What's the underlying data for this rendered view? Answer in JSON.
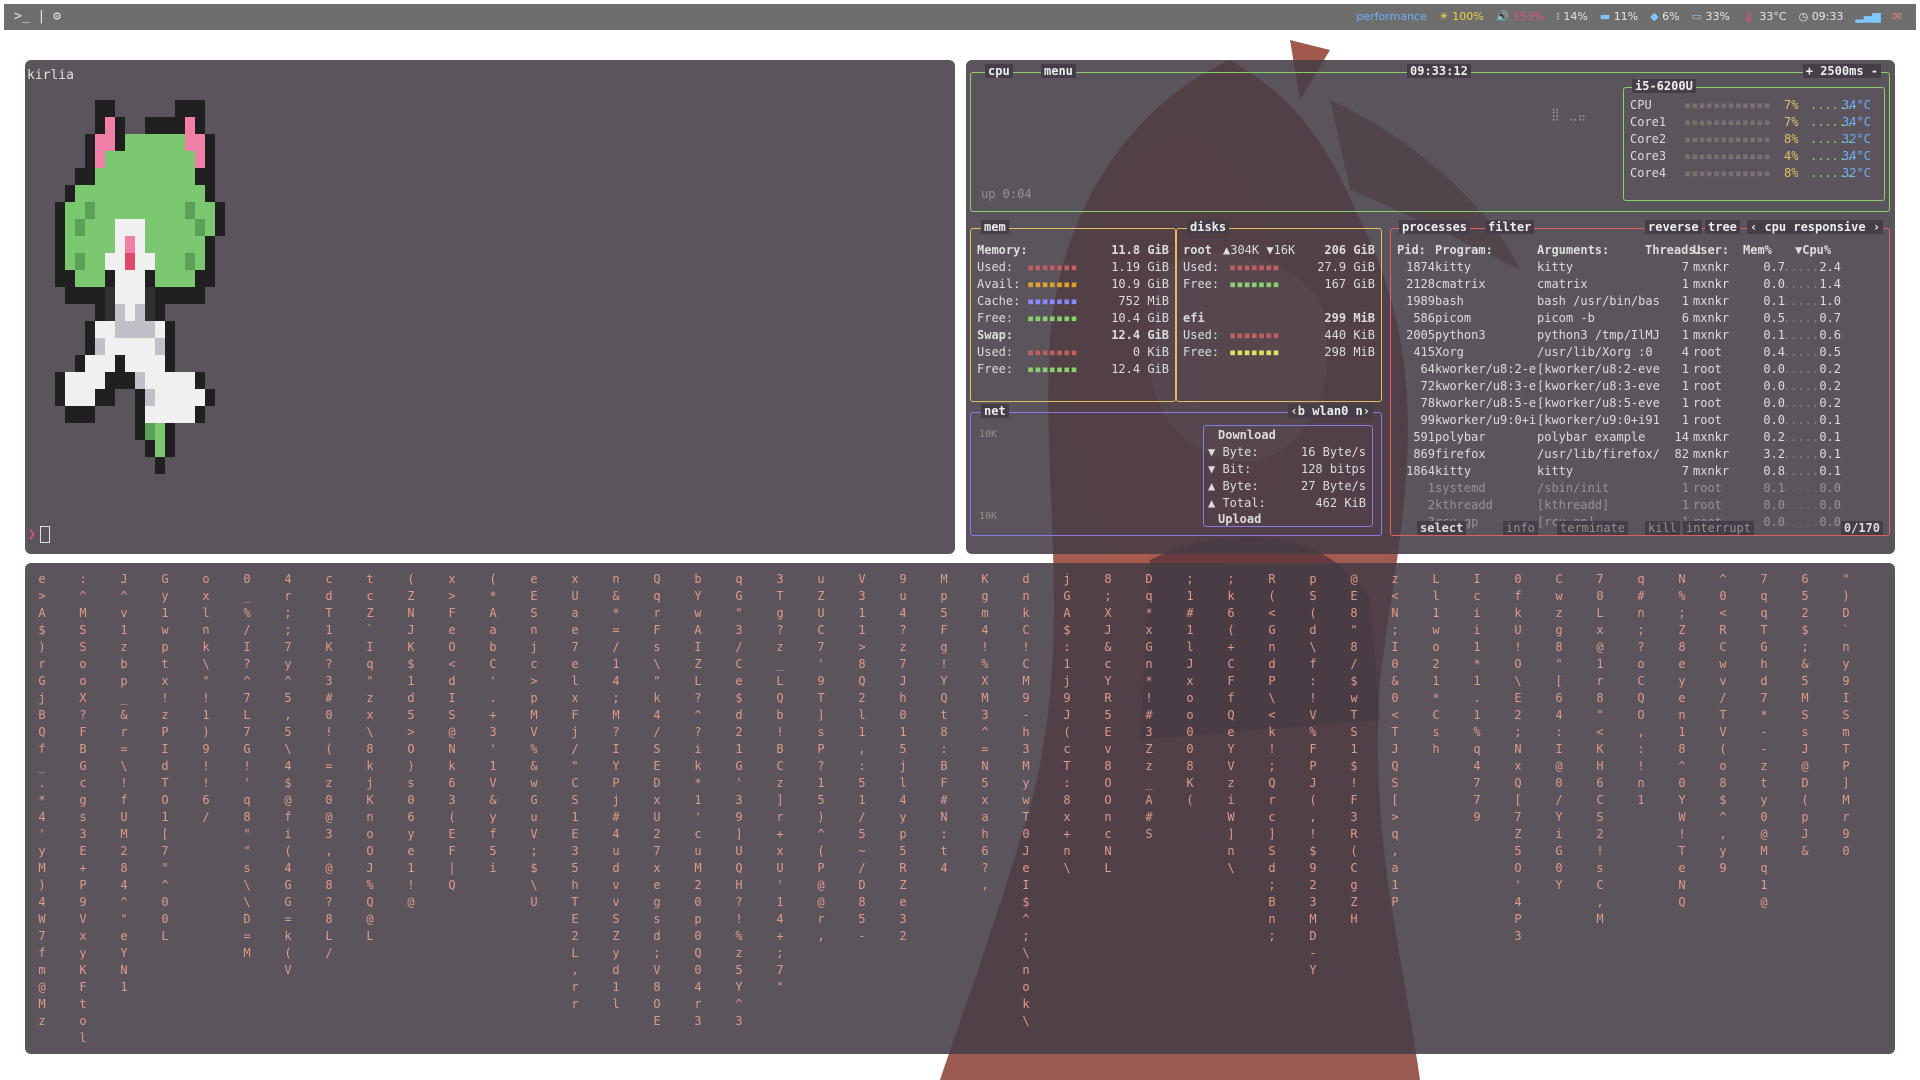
{
  "topbar": {
    "left_icon": "terminal-icon",
    "separator": "|",
    "gear": "gear-icon",
    "profile": "performance",
    "brightness": "100%",
    "volume": "153%",
    "cpu": "14%",
    "mem": "11%",
    "disk": "6%",
    "battery": "33%",
    "temp": "33°C",
    "clock": "09:33"
  },
  "kitty": {
    "title": "kirlia",
    "prompt": "❯"
  },
  "btop": {
    "cpu": {
      "tab_cpu": "cpu",
      "tab_menu": "menu",
      "clock": "09:33:12",
      "interval": "+ 2500ms -",
      "uptime": "up 0:04",
      "model": "i5-6200U",
      "cores": [
        {
          "name": "CPU",
          "pct": "7%",
          "temp": "34°C"
        },
        {
          "name": "Core1",
          "pct": "7%",
          "temp": "34°C"
        },
        {
          "name": "Core2",
          "pct": "8%",
          "temp": "32°C"
        },
        {
          "name": "Core3",
          "pct": "4%",
          "temp": "34°C"
        },
        {
          "name": "Core4",
          "pct": "8%",
          "temp": "32°C"
        }
      ]
    },
    "mem": {
      "label": "mem",
      "memory": {
        "k": "Memory:",
        "v": "11.8 GiB"
      },
      "used": {
        "k": "Used:",
        "v": "1.19 GiB"
      },
      "avail": {
        "k": "Avail:",
        "v": "10.9 GiB"
      },
      "cache": {
        "k": "Cache:",
        "v": "752 MiB"
      },
      "free": {
        "k": "Free:",
        "v": "10.4 GiB"
      },
      "swap": {
        "k": "Swap:",
        "v": "12.4 GiB"
      },
      "swap_used": {
        "k": "Used:",
        "v": "0 KiB"
      },
      "swap_free": {
        "k": "Free:",
        "v": "12.4 GiB"
      }
    },
    "disks": {
      "label": "disks",
      "root": {
        "name": "root",
        "io": "▲304K ▼16K",
        "size": "206 GiB",
        "used": "27.9 GiB",
        "free": "167 GiB"
      },
      "efi": {
        "name": "efi",
        "size": "299 MiB",
        "used": "440 KiB",
        "free": "298 MiB"
      },
      "used_k": "Used:",
      "free_k": "Free:"
    },
    "net": {
      "label": "net",
      "iface": "‹b wlan0 n›",
      "scale_top": "10K",
      "scale_bot": "10K",
      "download": "Download",
      "byte_dl": {
        "k": "▼ Byte:",
        "v": "16 Byte/s"
      },
      "bit_dl": {
        "k": "▼ Bit:",
        "v": "128 bitps"
      },
      "byte_ul": {
        "k": "▲ Byte:",
        "v": "27 Byte/s"
      },
      "total_ul": {
        "k": "▲ Total:",
        "v": "462 KiB"
      },
      "upload": "Upload"
    },
    "proc": {
      "label": "processes",
      "filter": "filter",
      "reverse": "reverse",
      "tree": "tree",
      "sort": "‹ cpu responsive ›",
      "headers": [
        "Pid:",
        "Program:",
        "Arguments:",
        "Threads:",
        "User:",
        "Mem%",
        "▼Cpu%"
      ],
      "rows": [
        [
          "1874",
          "kitty",
          "kitty",
          "7",
          "mxnkr",
          "0.7",
          "2.4"
        ],
        [
          "2128",
          "cmatrix",
          "cmatrix",
          "1",
          "mxnkr",
          "0.0",
          "1.4"
        ],
        [
          "1989",
          "bash",
          "bash /usr/bin/bas",
          "1",
          "mxnkr",
          "0.1",
          "1.0"
        ],
        [
          "586",
          "picom",
          "picom -b",
          "6",
          "mxnkr",
          "0.5",
          "0.7"
        ],
        [
          "2005",
          "python3",
          "python3 /tmp/IlMJ",
          "1",
          "mxnkr",
          "0.1",
          "0.6"
        ],
        [
          "415",
          "Xorg",
          "/usr/lib/Xorg :0",
          "4",
          "root",
          "0.4",
          "0.5"
        ],
        [
          "64",
          "kworker/u8:2-e",
          "[kworker/u8:2-eve",
          "1",
          "root",
          "0.0",
          "0.2"
        ],
        [
          "72",
          "kworker/u8:3-e",
          "[kworker/u8:3-eve",
          "1",
          "root",
          "0.0",
          "0.2"
        ],
        [
          "78",
          "kworker/u8:5-e",
          "[kworker/u8:5-eve",
          "1",
          "root",
          "0.0",
          "0.2"
        ],
        [
          "99",
          "kworker/u9:0+i",
          "[kworker/u9:0+i91",
          "1",
          "root",
          "0.0",
          "0.1"
        ],
        [
          "591",
          "polybar",
          "polybar example",
          "14",
          "mxnkr",
          "0.2",
          "0.1"
        ],
        [
          "869",
          "firefox",
          "/usr/lib/firefox/",
          "82",
          "mxnkr",
          "3.2",
          "0.1"
        ],
        [
          "1864",
          "kitty",
          "kitty",
          "7",
          "mxnkr",
          "0.8",
          "0.1"
        ],
        [
          "1",
          "systemd",
          "/sbin/init",
          "1",
          "root",
          "0.1",
          "0.0"
        ],
        [
          "2",
          "kthreadd",
          "[kthreadd]",
          "1",
          "root",
          "0.0",
          "0.0"
        ],
        [
          "3",
          "rcu_gp",
          "[rcu_gp]",
          "1",
          "root",
          "0.0",
          "0.0"
        ]
      ],
      "select": "select",
      "info": "info",
      "terminate": "terminate",
      "kill": "kill",
      "interrupt": "interrupt",
      "count": "0/170"
    }
  },
  "matrix": {
    "columns": [
      "e > A $ ) r G j B Q f _ . * 4 ' y M ) 4 W 7 f m @ M z",
      ": ^ M S S o o X ? F B G c g s 3 E + P 9 V x y K F t o l",
      "J ^ v 1 z b p _ & r = \\ ! f U M 2 8 4 ^ \" e Y N 1",
      "G y 1 w p t x ! z P I d T O 1 [ 7 \" ^ 0 0 L",
      "o x l n k \\ \" ! 1 ) 9 ! ! 6 /",
      "0 _ % / I ? ^ 7 L 7 G ! ' q 8 \" \" s \\ \\ D = M",
      "4 r ; ; 7 y ^ 5 , 5 \\ 4 $ @ f i ( 4 G G = k ( V",
      "c d T 1 K ? 3 # 0 ! ( = z 0 @ 3 , @ 8 ? 8 L /",
      "t c Z ` I q \" z x \\ 8 k j K n o O J % Q @ L",
      "( Z N J K $ 1 d 5 > O ) s 0 6 y e 1 ! @",
      "x > F e O < d I S @ N k 6 3 ( E F | Q",
      "( * A a b C ' . + 3 ' 1 V & y f 5 i",
      "e E S n j c > p M V % & w G u V ; $ \\ U",
      "x U a e 7 e l x F j / \" C S 1 E 3 5 h T E 2 L , r r",
      "n & * = / 1 4 ; M ? I Y P j # 4 u d v v S Z y d 1 l",
      "Q q r F s \\ \" k 4 / S E D x U 2 7 x e g s d ; V 8 O E",
      "b Y w A I Z L ? ^ ? i k * 1 ' c u M 2 0 p 0 Q 0 4 r 3",
      "q G \" 3 / C e $ d 2 1 G ' 3 9 ] U Q H ? ! % z 5 Y ^ 3",
      "3 T g ? z _ L Q b ! B C z ] r + x U ' 1 4 + ; 7 \"",
      "u Z U C 7 ' 9 T ] s P ? 1 5 ) ^ ( P @ @ r ,",
      "V 3 1 1 > 8 Q 2 l 1 , : 5 1 / 5 ~ / D 8 5 -",
      "9 u 4 ? z 7 J h 0 1 5 j l 4 y p 5 R Z e 3 2",
      "M p 5 F g ! Y Q t 8 : B F # N : t 4",
      "K g m 4 ! % X M 3 ^ = N 5 x a h 6 ? ,",
      "d n k C ! C M 9 - h 3 M y w T 0 J e I $ ^ ; \\ n o k \\",
      "j G A $ : 1 j 9 J ( c T : 8 x + n \\",
      "8 ; X J & c Y R 5 E v 8 O O n c N L",
      "D q * x G n * ! # 3 Z z _ A # S",
      "; 1 # 1 l J x o o 0 0 8 K (",
      "; k 6 ( + C F f Q e Y V z i W ] n \\",
      "R ( < G n d P \\ < k ! ; Q r c ] S d ; B n ;",
      "p S ( d \\ f : ! V % F P J ( , ! $ 9 2 3 M D - Y",
      "@ E 8 \" 8 / $ w T S 1 $ ! F 3 R ( C g Z H",
      "z < N ; I 0 & 0 < T J Q S [ > q , a 1 P",
      "L l 1 w o 2 1 * C s h",
      "I c i i 1 * 1 . 1 % q 4 7 7 9",
      "0 f k U ! O \\ E 2 ; N x Q [ 7 Z 5 O ' 4 P 3",
      "C w z g 8 \" [ 6 4 : I @ 0 / Y i G 0 Y",
      "7 0 L x @ 1 r 8 \" < K H 6 C S 2 ! s C , M",
      "q # n ; ? o C Q O , : ! n 1",
      "N % ; Z 8 e y e n 1 8 ^ 0 Y W ! T e N Q",
      "^ 0 < R C w v / T V ( o 8 $ ^ , y 9",
      "7 q q T G h d 7 * - - z t y 0 @ M q 1 @",
      "6 5 2 $ ; & 5 M S s J @ D ( p J &",
      "\" ) D ` n y 9 I S m T P ] M r 9 0"
    ]
  }
}
